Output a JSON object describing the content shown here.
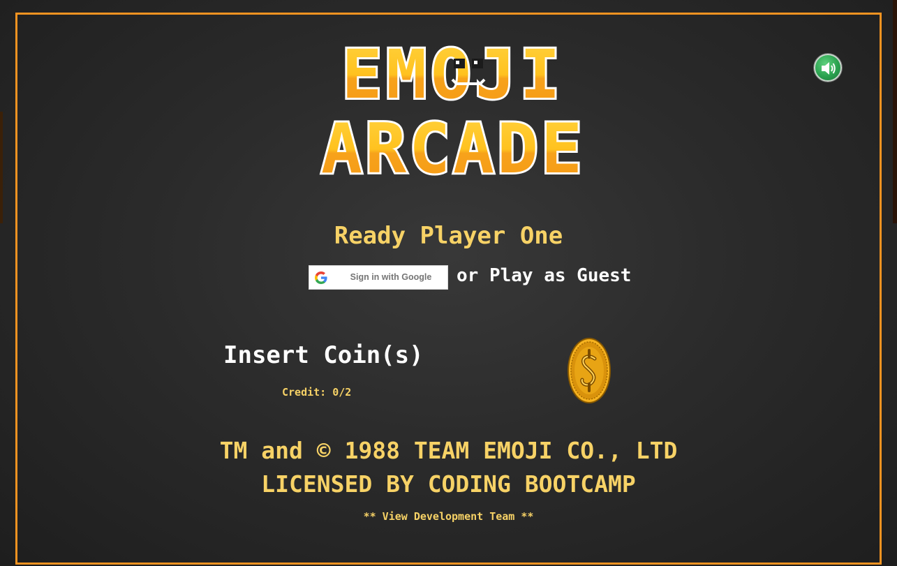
{
  "logo": {
    "line1": "EMOJI",
    "line2": "ARCADE"
  },
  "sound": {
    "icon": "speaker-volume-icon",
    "color": "#2aa24f"
  },
  "login": {
    "heading": "Ready Player One",
    "google_button_label": "Sign in with Google",
    "guest_text": "or Play as Guest"
  },
  "coin_panel": {
    "insert_label": "Insert Coin(s)",
    "credit_text": "Credit: 0/2",
    "coin_icon": "gold-coin-dollar-icon"
  },
  "footer": {
    "copyright_line1": "TM and © 1988 TEAM EMOJI CO., LTD",
    "copyright_line2": "LICENSED BY CODING BOOTCAMP",
    "dev_team_link": "** View Development Team **"
  },
  "colors": {
    "accent": "#f39321",
    "text_yellow": "#f7d266",
    "logo_top": "#ffd23f",
    "logo_bottom": "#f7a21b",
    "background": "#2b2b2b"
  }
}
